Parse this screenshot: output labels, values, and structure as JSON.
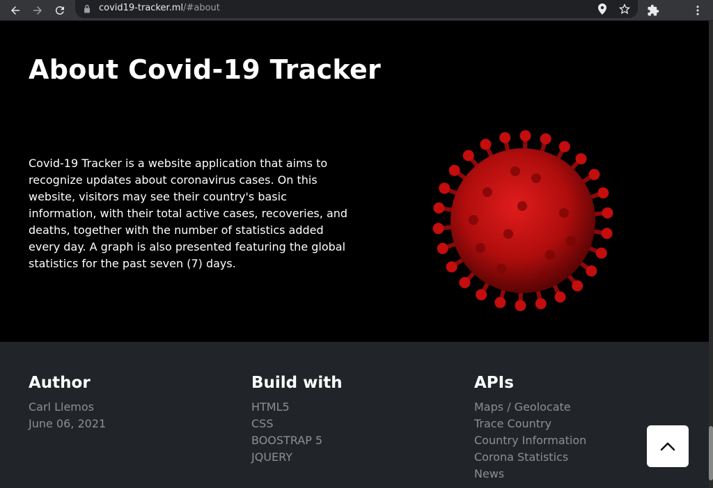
{
  "browser": {
    "url_host": "covid19-tracker.ml",
    "url_path": "/#about"
  },
  "about": {
    "title": "About Covid-19 Tracker",
    "description": "Covid-19 Tracker is a website application that aims to recognize updates about coronavirus cases. On this website, visitors may see their country's basic information, with their total active cases, recoveries, and deaths, together with the number of statistics added every day. A graph is also presented featuring the global statistics for the past seven (7) days.",
    "image_icon": "coronavirus-icon",
    "virus_color": "#c40d0d"
  },
  "footer": {
    "author": {
      "heading": "Author",
      "items": [
        "Carl Llemos",
        "June 06, 2021"
      ]
    },
    "build": {
      "heading": "Build with",
      "items": [
        "HTML5",
        "CSS",
        "BOOSTRAP 5",
        "JQUERY"
      ]
    },
    "apis": {
      "heading": "APIs",
      "items": [
        "Maps / Geolocate",
        "Trace Country",
        "Country Information",
        "Corona Statistics",
        "News"
      ]
    }
  },
  "scroll_top_icon": "chevron-up-icon"
}
